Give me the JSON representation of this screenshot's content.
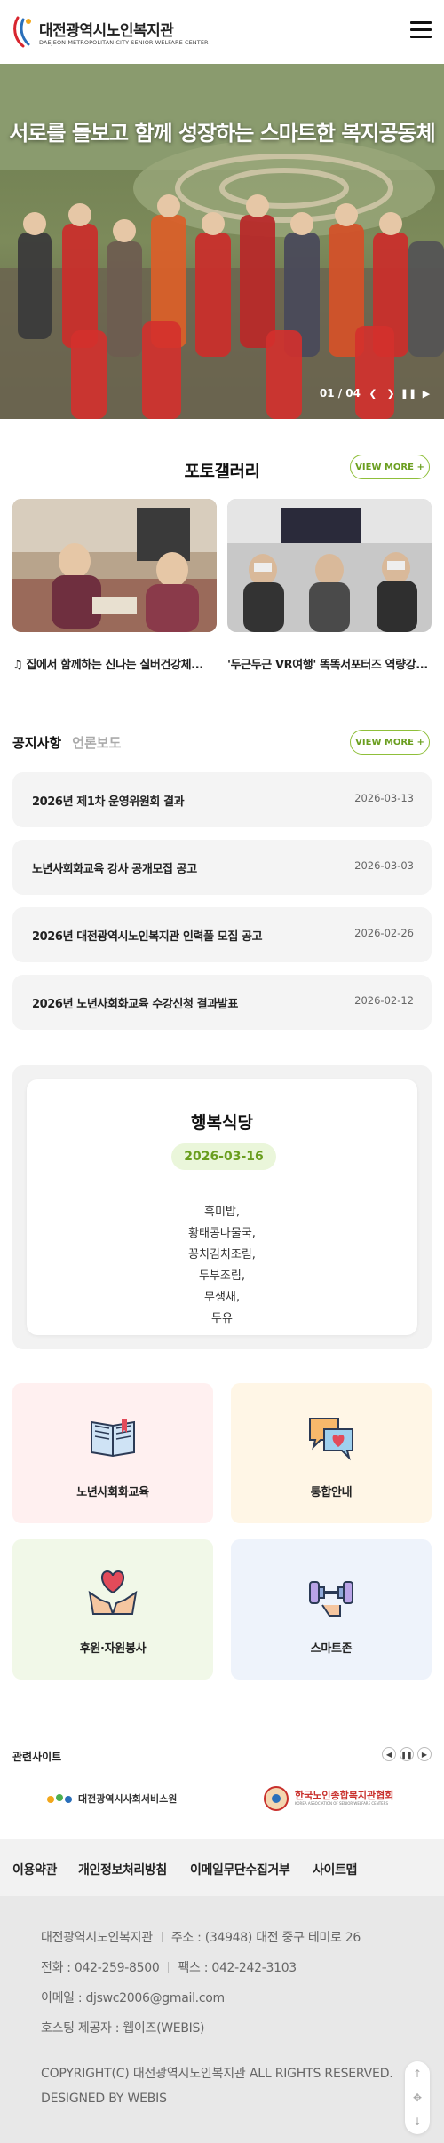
{
  "header": {
    "logo_ko": "대전광역시노인복지관",
    "logo_en": "DAEJEON METROPOLITAN CITY SENIOR WELFARE CENTER",
    "menu_icon": "hamburger-icon"
  },
  "hero": {
    "title": "서로를 돌보고 함께 성장하는 스마트한 복지공동체",
    "counter": "01 / 04",
    "controls": [
      "prev-icon",
      "next-icon",
      "pause-icon",
      "play-icon"
    ]
  },
  "gallery": {
    "title": "포토갤러리",
    "more": "VIEW MORE +",
    "items": [
      {
        "caption": "♫ 집에서 함께하는 신나는 실버건강체..."
      },
      {
        "caption": "'두근두근 VR여행' 똑똑서포터즈 역량강..."
      }
    ]
  },
  "notices": {
    "tabs": [
      "공지사항",
      "언론보도"
    ],
    "more": "VIEW MORE +",
    "items": [
      {
        "title": "2026년 제1차 운영위원회 결과",
        "date": "2026-03-13"
      },
      {
        "title": "노년사회화교육 강사 공개모집 공고",
        "date": "2026-03-03"
      },
      {
        "title": "2026년 대전광역시노인복지관 인력풀 모집 공고",
        "date": "2026-02-26"
      },
      {
        "title": "2026년 노년사회화교육 수강신청 결과발표",
        "date": "2026-02-12"
      }
    ]
  },
  "meal": {
    "title": "행복식당",
    "date": "2026-03-16",
    "menu": [
      "흑미밥,",
      "황태콩나물국,",
      "꽁치김치조림,",
      "두부조림,",
      "무생채,",
      "두유"
    ]
  },
  "quick_links": [
    {
      "label": "노년사회화교육",
      "icon": "book-icon",
      "bg": "#fff0f0"
    },
    {
      "label": "통합안내",
      "icon": "chat-heart-icon",
      "bg": "#fff6e6"
    },
    {
      "label": "후원·자원봉사",
      "icon": "hands-heart-icon",
      "bg": "#f1f8e8"
    },
    {
      "label": "스마트존",
      "icon": "dumbbell-icon",
      "bg": "#eef3fb"
    }
  ],
  "related": {
    "title": "관련사이트",
    "sites": [
      "대전광역시사회서비스원",
      "한국노인종합복지관협회",
      "KOREA ASSOCIATION OF SENIOR WELFARE CENTERS"
    ]
  },
  "footer": {
    "links": [
      "이용약관",
      "개인정보처리방침",
      "이메일무단수집거부",
      "사이트맵"
    ],
    "org": "대전광역시노인복지관",
    "address": "주소 : (34948) 대전 중구 테미로 26",
    "phone": "전화 : 042-259-8500",
    "fax": "팩스 : 042-242-3103",
    "email": "이메일 : djswc2006@gmail.com",
    "hosting": "호스팅 제공자 : 웹이즈(WEBIS)",
    "copyright": "COPYRIGHT(C) 대전광역시노인복지관 ALL RIGHTS RESERVED.",
    "designed": "DESIGNED BY WEBIS"
  },
  "colors": {
    "accent": "#6a9e1f",
    "accent_light": "#eaf6da",
    "brand_red": "#d8262f"
  }
}
